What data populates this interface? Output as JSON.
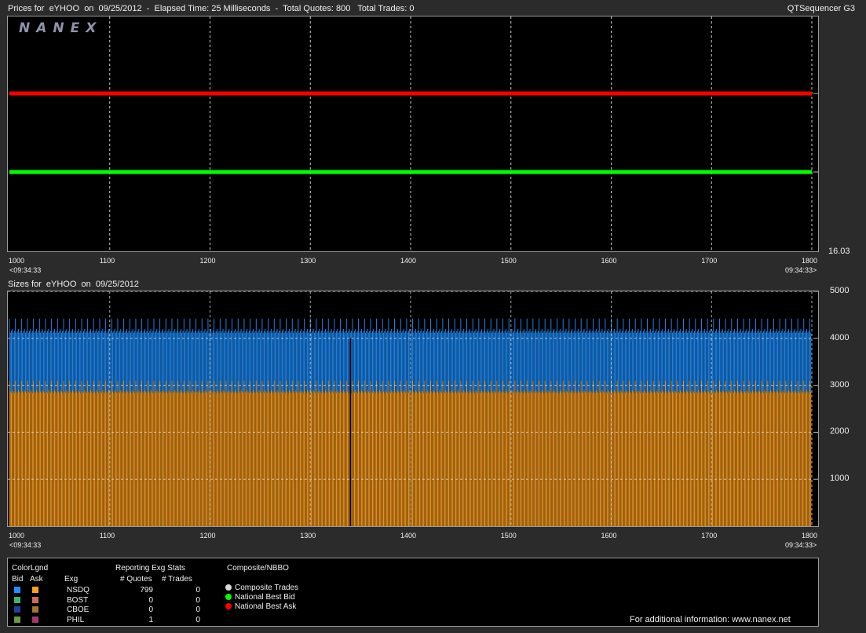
{
  "header": {
    "title": "Prices for  eYHOO  on  09/25/2012  -  Elapsed Time: 25 Milliseconds  -  Total Quotes: 800   Total Trades: 0",
    "app_name": "QTSequencer G3"
  },
  "logo": "NANEX",
  "chart_data": [
    {
      "type": "line",
      "x_ticks": [
        1000,
        1100,
        1200,
        1300,
        1400,
        1500,
        1600,
        1700,
        1800
      ],
      "time_left": "<09:34:33",
      "time_right": "09:34:33>",
      "y_label": "16.03",
      "xlim": [
        1000,
        1800
      ],
      "grid": true,
      "series": [
        {
          "name": "National Best Ask",
          "color": "#ff0000",
          "x": [
            1000,
            1800
          ],
          "y": [
            16.04,
            16.04
          ]
        },
        {
          "name": "National Best Bid",
          "color": "#00ff00",
          "x": [
            1000,
            1800
          ],
          "y": [
            16.03,
            16.03
          ]
        }
      ]
    },
    {
      "type": "bar",
      "title": "Sizes for  eYHOO  on  09/25/2012",
      "x_ticks": [
        1000,
        1100,
        1200,
        1300,
        1400,
        1500,
        1600,
        1700,
        1800
      ],
      "time_left": "<09:34:33",
      "time_right": "09:34:33>",
      "y_ticks": [
        1000,
        2000,
        3000,
        4000,
        5000
      ],
      "ylim": [
        0,
        5000
      ],
      "xlim": [
        1000,
        1800
      ],
      "grid": true,
      "series": [
        {
          "name": "Ask",
          "color": "#ffa020",
          "typical": 2900,
          "peak": 3100
        },
        {
          "name": "Bid",
          "color": "#1e90ff",
          "typical": 4200,
          "peak": 4420
        }
      ],
      "peak_every": 6
    }
  ],
  "legend": {
    "color_title": "ColorLgnd",
    "bid_label": "Bid",
    "ask_label": "Ask",
    "exg_label": "Exg",
    "stats_title": "Reporting Exg Stats",
    "quotes_label": "# Quotes",
    "trades_label": "# Trades",
    "composite_title": "Composite/NBBO",
    "rows": [
      {
        "exg": "NSDQ",
        "bid_color": "#1e90ff",
        "ask_color": "#ffa020",
        "quotes": "799",
        "trades": "0"
      },
      {
        "exg": "BOST",
        "bid_color": "#3cb371",
        "ask_color": "#cd6b5b",
        "quotes": "0",
        "trades": "0"
      },
      {
        "exg": "CBOE",
        "bid_color": "#1f3fa0",
        "ask_color": "#a0782c",
        "quotes": "0",
        "trades": "0"
      },
      {
        "exg": "PHIL",
        "bid_color": "#6b9a3a",
        "ask_color": "#a03a6a",
        "quotes": "1",
        "trades": "0"
      }
    ],
    "composite": [
      {
        "label": "Composite Trades",
        "color": "#d8d8d8"
      },
      {
        "label": "National Best Bid",
        "color": "#00ff00"
      },
      {
        "label": "National Best Ask",
        "color": "#ff0000"
      }
    ],
    "footer": "For additional information: www.nanex.net"
  }
}
